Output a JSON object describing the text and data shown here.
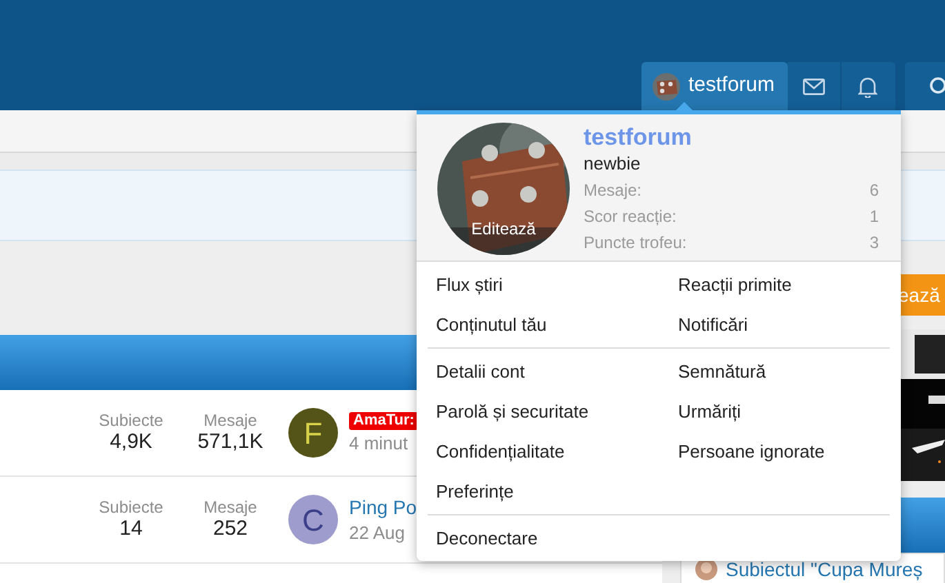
{
  "header": {
    "user_tab": {
      "label": "testforum",
      "selected": true
    }
  },
  "forums": [
    {
      "stats": [
        {
          "label": "Subiecte",
          "value": "4,9K"
        },
        {
          "label": "Mesaje",
          "value": "571,1K"
        }
      ],
      "avatar_letter": "F",
      "color": "#545419",
      "latest": {
        "badge": "AmaTur:",
        "meta": "4 minut"
      }
    },
    {
      "stats": [
        {
          "label": "Subiecte",
          "value": "14"
        },
        {
          "label": "Mesaje",
          "value": "252"
        }
      ],
      "avatar_letter": "C",
      "color": "#9e9ccc",
      "latest": {
        "title": "Ping Po",
        "meta": "22 Aug"
      }
    }
  ],
  "sidebar": {
    "button": "ează",
    "post_title": "Subiectul \"Cupa Mureș"
  },
  "account_menu": {
    "username": "testforum",
    "rank": "newbie",
    "edit_label": "Editează",
    "stats": [
      {
        "label": "Mesaje:",
        "value": "6"
      },
      {
        "label": "Scor reacție:",
        "value": "1"
      },
      {
        "label": "Puncte trofeu:",
        "value": "3"
      }
    ],
    "groups": [
      [
        "Flux știri",
        "Reacții primite",
        "Conținutul tău",
        "Notificări"
      ],
      [
        "Detalii cont",
        "Semnătură",
        "Parolă și securitate",
        "Urmăriți",
        "Confidențialitate",
        "Persoane ignorate",
        "Preferințe"
      ],
      [
        "Deconectare"
      ]
    ]
  }
}
